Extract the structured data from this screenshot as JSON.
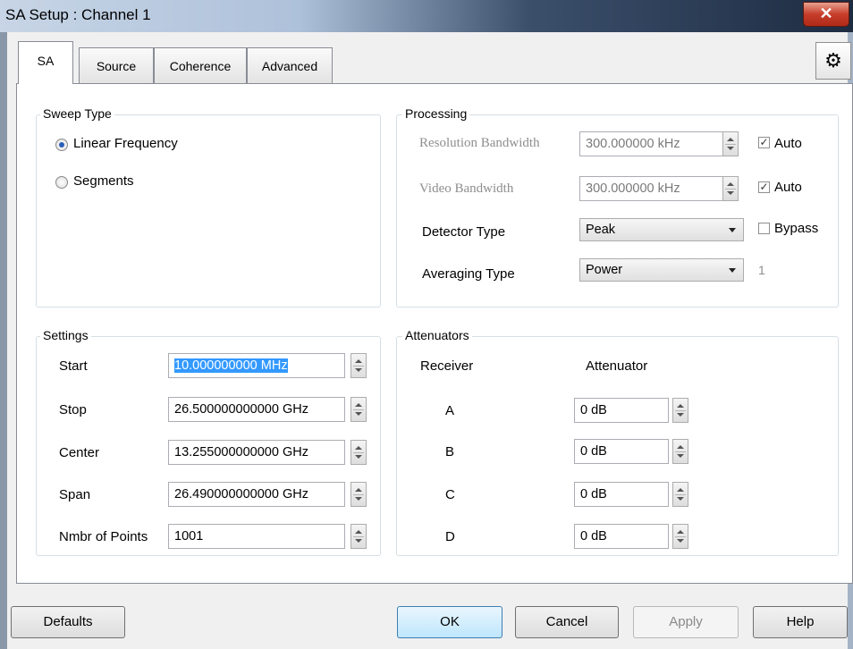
{
  "window": {
    "title": "SA Setup : Channel 1",
    "close_label": "✕"
  },
  "tabs": [
    {
      "label": "SA",
      "active": true
    },
    {
      "label": "Source",
      "active": false
    },
    {
      "label": "Coherence",
      "active": false
    },
    {
      "label": "Advanced",
      "active": false
    }
  ],
  "gear_icon": "⚙",
  "sweep_type": {
    "legend": "Sweep Type",
    "options": [
      {
        "label": "Linear Frequency",
        "selected": true
      },
      {
        "label": "Segments",
        "selected": false
      }
    ]
  },
  "processing": {
    "legend": "Processing",
    "resolution_bandwidth": {
      "label": "Resolution Bandwidth",
      "value": "300.000000 kHz",
      "auto_label": "Auto",
      "auto_checked": true
    },
    "video_bandwidth": {
      "label": "Video Bandwidth",
      "value": "300.000000 kHz",
      "auto_label": "Auto",
      "auto_checked": true
    },
    "detector_type": {
      "label": "Detector Type",
      "value": "Peak",
      "bypass_label": "Bypass",
      "bypass_checked": false
    },
    "averaging_type": {
      "label": "Averaging Type",
      "value": "Power",
      "count": "1"
    }
  },
  "settings": {
    "legend": "Settings",
    "start": {
      "label": "Start",
      "value": "10.000000000 MHz"
    },
    "stop": {
      "label": "Stop",
      "value": "26.500000000000 GHz"
    },
    "center": {
      "label": "Center",
      "value": "13.255000000000 GHz"
    },
    "span": {
      "label": "Span",
      "value": "26.490000000000 GHz"
    },
    "points": {
      "label": "Nmbr of Points",
      "value": "1001"
    }
  },
  "attenuators": {
    "legend": "Attenuators",
    "col_receiver": "Receiver",
    "col_attenuator": "Attenuator",
    "rows": [
      {
        "receiver": "A",
        "value": "0 dB"
      },
      {
        "receiver": "B",
        "value": "0 dB"
      },
      {
        "receiver": "C",
        "value": "0 dB"
      },
      {
        "receiver": "D",
        "value": "0 dB"
      }
    ]
  },
  "buttons": {
    "defaults": "Defaults",
    "ok": "OK",
    "cancel": "Cancel",
    "apply": "Apply",
    "help": "Help"
  }
}
